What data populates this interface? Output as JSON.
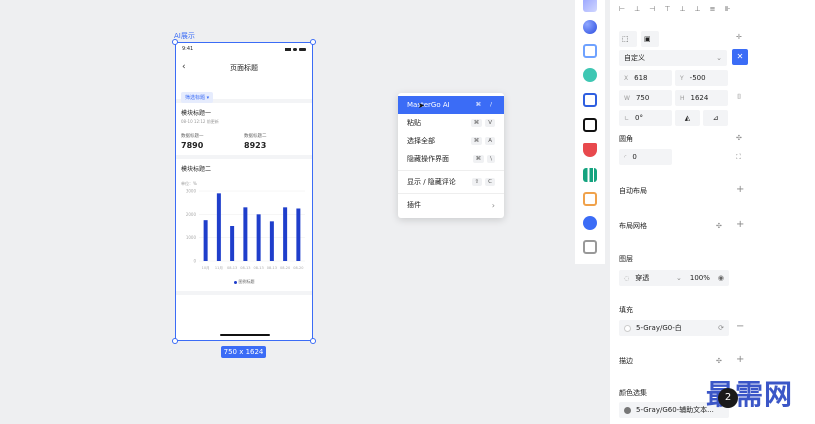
{
  "frame": {
    "label": "AI展示",
    "size_badge": "750 x 1624",
    "status_time": "9:41",
    "nav_title": "页面标题",
    "filter_chip": "筛选标题 ▾",
    "module1": {
      "title": "模块标题一",
      "subtitle": "08-10 12:12 前更新",
      "metrics": [
        {
          "label": "数据标题一",
          "value": "7890"
        },
        {
          "label": "数据标题二",
          "value": "8923"
        }
      ]
    },
    "module2": {
      "title": "模块标题二",
      "unit": "单位：%",
      "legend": "图例标题"
    }
  },
  "chart_data": {
    "type": "bar",
    "categories": [
      "10月",
      "11月",
      "08-13",
      "08-13",
      "08-13",
      "08-13",
      "08-20",
      "08-20"
    ],
    "values": [
      1750,
      2900,
      1500,
      2300,
      2000,
      1700,
      2300,
      2250
    ],
    "ylim": [
      0,
      3000
    ],
    "yticks": [
      "3000",
      "2000",
      "1000",
      "0"
    ],
    "color": "#1f3ecb"
  },
  "context_menu": {
    "items": [
      {
        "label": "MasterGo AI",
        "keys": [
          "⌘",
          "/"
        ],
        "active": true
      },
      {
        "label": "粘贴",
        "keys": [
          "⌘",
          "V"
        ]
      },
      {
        "label": "选择全部",
        "keys": [
          "⌘",
          "A"
        ]
      },
      {
        "label": "隐藏操作界面",
        "keys": [
          "⌘",
          "\\"
        ]
      },
      {
        "label": "显示 / 隐藏评论",
        "keys": [
          "⇧",
          "C"
        ]
      },
      {
        "label": "插件",
        "keys": []
      }
    ]
  },
  "panel": {
    "preset": "自定义",
    "x_label": "X",
    "x_value": "618",
    "y_label": "Y",
    "y_value": "-500",
    "w_label": "W",
    "w_value": "750",
    "h_label": "H",
    "h_value": "1624",
    "rotation": "0°",
    "corner_title": "圆角",
    "corner_value": "0",
    "auto_layout": "自动布局",
    "layout_grid": "布局网格",
    "layer_title": "图层",
    "blend_mode": "穿透",
    "opacity": "100%",
    "fill_title": "填充",
    "fill_value": "5-Gray/G0-白",
    "stroke_title": "描边",
    "color_select_title": "颜色选集",
    "color_select_value": "5-Gray/G60-辅助文本..."
  },
  "watermark": "最需网",
  "avatar_badge": "2"
}
